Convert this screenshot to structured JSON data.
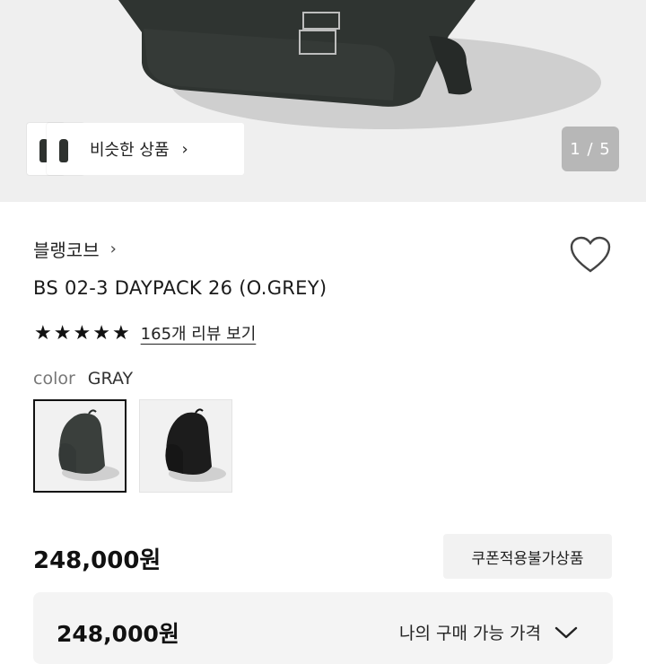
{
  "hero": {
    "similar_label": "비슷한 상품",
    "similar_chevron": "›",
    "pager": "1 / 5",
    "icons": [
      "backpack-photo",
      "chevron-right-icon"
    ]
  },
  "product": {
    "brand": "블랭코브",
    "brand_chevron": "›",
    "title": "BS 02-3 DAYPACK 26 (O.GREY)",
    "stars": [
      "★",
      "★",
      "★",
      "★",
      "★"
    ],
    "review_link": "165개 리뷰 보기",
    "color_label": "color",
    "color_value": "GRAY",
    "swatches": [
      {
        "name": "GRAY",
        "selected": true,
        "color": "#3a3f3c"
      },
      {
        "name": "BLACK",
        "selected": false,
        "color": "#1c1c1c"
      }
    ],
    "wishlist_icon": "heart-icon"
  },
  "pricing": {
    "price": "248,000원",
    "coupon_badge": "쿠폰적용불가상품",
    "buy_price": "248,000원",
    "buy_toggle": "나의 구매 가능 가격",
    "toggle_icon": "chevron-down-icon"
  },
  "colors": {
    "background_gray": "#efefef",
    "product_dark": "#2f3431",
    "pager_bg": "#b7b7b7"
  }
}
